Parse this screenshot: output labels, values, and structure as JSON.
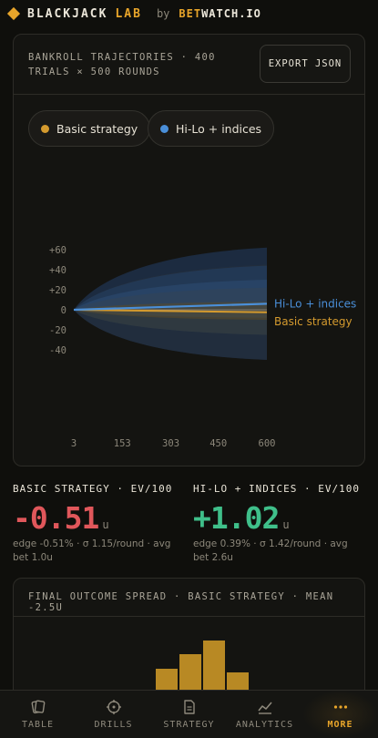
{
  "header": {
    "brand": "BLACKJACK",
    "brand_suffix": "LAB",
    "by": "by",
    "partner_bet": "BET",
    "partner_rest": "WATCH.IO"
  },
  "chart_card": {
    "title": "BANKROLL TRAJECTORIES · 400 TRIALS × 500 ROUNDS",
    "export_label": "EXPORT JSON",
    "legend": [
      {
        "label": "Basic strategy",
        "color": "#d49a2e"
      },
      {
        "label": "Hi-Lo + indices",
        "color": "#4a8fd9"
      }
    ],
    "end_labels": {
      "hilo": "Hi-Lo + indices",
      "basic": "Basic strategy"
    }
  },
  "chart_data": {
    "type": "area",
    "title": "BANKROLL TRAJECTORIES · 400 TRIALS × 500 ROUNDS",
    "x_ticks": [
      "3",
      "153",
      "303",
      "450",
      "600"
    ],
    "y_ticks": [
      "+60",
      "+40",
      "+20",
      "0",
      "-20",
      "-40"
    ],
    "xlim": [
      3,
      600
    ],
    "ylim": [
      -54,
      66
    ],
    "grid": false,
    "legend_position": "top-left",
    "series": [
      {
        "name": "Basic strategy",
        "color": "#d49a2e",
        "mean_start": 0,
        "mean_end": -2.5,
        "band_end_outer": [
          -50,
          45
        ],
        "band_end_mid": [
          -25,
          22
        ],
        "band_end_inner": [
          -10,
          8
        ]
      },
      {
        "name": "Hi-Lo + indices",
        "color": "#4a8fd9",
        "mean_start": 0,
        "mean_end": 6,
        "band_end_outer": [
          -50,
          62
        ],
        "band_end_mid": [
          -25,
          44
        ],
        "band_end_inner": [
          -8,
          30
        ]
      }
    ]
  },
  "stats": {
    "basic": {
      "label": "BASIC STRATEGY · EV/100",
      "value": "-0.51",
      "unit": "u",
      "sub": "edge -0.51% · σ 1.15/round · avg bet 1.0u",
      "color": "#e0575b"
    },
    "hilo": {
      "label": "HI-LO + INDICES · EV/100",
      "value": "+1.02",
      "unit": "u",
      "sub": "edge 0.39% · σ 1.42/round · avg bet 2.6u",
      "color": "#3fbf8a"
    }
  },
  "spread_card": {
    "title": "FINAL OUTCOME SPREAD · BASIC STRATEGY · MEAN -2.5U",
    "bars": [
      0.45,
      0.74,
      1.0,
      0.38
    ]
  },
  "nav": [
    {
      "label": "TABLE",
      "icon": "cards-icon"
    },
    {
      "label": "DRILLS",
      "icon": "target-icon"
    },
    {
      "label": "STRATEGY",
      "icon": "document-icon"
    },
    {
      "label": "ANALYTICS",
      "icon": "chart-icon"
    },
    {
      "label": "MORE",
      "icon": "dots-icon"
    }
  ]
}
